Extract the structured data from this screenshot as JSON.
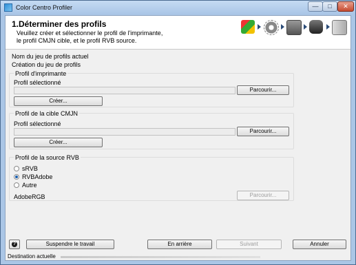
{
  "window": {
    "title": "Color Centro Profiler",
    "min": "—",
    "max": "□",
    "close": "✕"
  },
  "header": {
    "title": "1.Déterminer des profils",
    "description_line1": "Veuillez créer et sélectionner le profil de l'imprimante,",
    "description_line2": "le profil CMJN cible, et le profil RVB source.",
    "step_icons": [
      "printer-profile-icon",
      "gear-icon",
      "printer-icon",
      "measure-device-icon",
      "folder-export-icon"
    ]
  },
  "profile_set": {
    "label": "Nom du jeu de profils actuel",
    "value": "Création du jeu de profils"
  },
  "printer_profile": {
    "group_label": "Profil d'imprimante",
    "selected_label": "Profil sélectionné",
    "selected_value": "",
    "browse_label": "Parcourir...",
    "create_label": "Créer..."
  },
  "cmyk_profile": {
    "group_label": "Profil de la cible CMJN",
    "selected_label": "Profil sélectionné",
    "selected_value": "",
    "browse_label": "Parcourir...",
    "create_label": "Créer..."
  },
  "rgb_source": {
    "group_label": "Profil de la source RVB",
    "options": [
      {
        "label": "sRVB",
        "selected": false
      },
      {
        "label": "RVBAdobe",
        "selected": true
      },
      {
        "label": "Autre",
        "selected": false
      }
    ],
    "current_value": "AdobeRGB",
    "browse_label": "Parcourir..."
  },
  "footer": {
    "help_label": "?",
    "suspend_label": "Suspendre le travail",
    "back_label": "En arrière",
    "next_label": "Suivant",
    "cancel_label": "Annuler"
  },
  "status": {
    "label": "Destination actuelle"
  }
}
